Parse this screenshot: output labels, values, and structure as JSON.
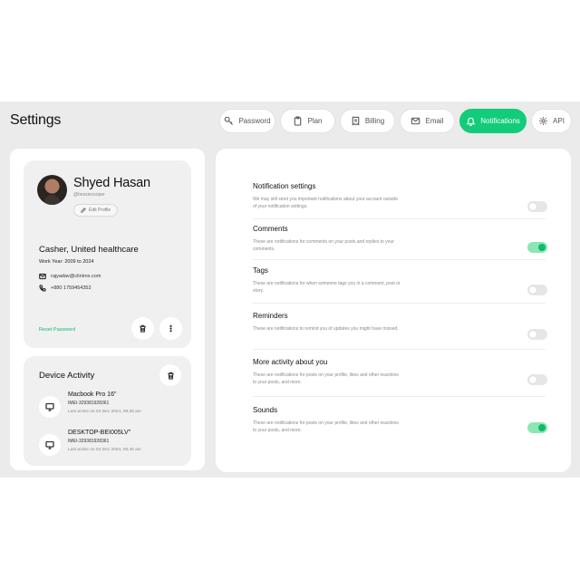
{
  "header": {
    "title": "Settings"
  },
  "tabs": [
    {
      "label": "Password",
      "icon": "key-icon",
      "active": false
    },
    {
      "label": "Plan",
      "icon": "clipboard-icon",
      "active": false
    },
    {
      "label": "Billing",
      "icon": "receipt-icon",
      "active": false
    },
    {
      "label": "Email",
      "icon": "mail-icon",
      "active": false
    },
    {
      "label": "Notifications",
      "icon": "bell-icon",
      "active": true
    },
    {
      "label": "API",
      "icon": "gear-icon",
      "active": false
    }
  ],
  "profile": {
    "name": "Shyed Hasan",
    "handle": "@bessiecooper",
    "edit_label": "Edit Profile",
    "job_title": "Casher, United healthcare",
    "work_year": "Work Year: 2009 to 2024",
    "email": "rajyadav@clinirox.com",
    "phone": "+880 1759454352",
    "reset_label": "Reset Password"
  },
  "device_activity": {
    "title": "Device Activity",
    "devices": [
      {
        "name": "Macbook Pro 16\"",
        "imei": "IMEI-329381928361",
        "last_active": "Last active on 04 Dec 2024, 08:28 am"
      },
      {
        "name": "DESKTOP-BEI005LV\"",
        "imei": "IMEI-329381928361",
        "last_active": "Last active on 04 Dec 2024, 06:45 am"
      }
    ]
  },
  "notifications": [
    {
      "title": "Notification settings",
      "desc": "We may still send you important notifications about your account outside of your notification settings.",
      "enabled": false
    },
    {
      "title": "Comments",
      "desc": "These are notifications for comments on your posts and replies to your comments.",
      "enabled": true
    },
    {
      "title": "Tags",
      "desc": "These are notifications for when someone tags you in a comment, post or story.",
      "enabled": false
    },
    {
      "title": "Reminders",
      "desc": "These are notifications to remind you of updates you might have missed.",
      "enabled": false
    },
    {
      "title": "More activity about you",
      "desc": "These are notifications for posts on your profile, likes and other reactions to your posts, and more.",
      "enabled": false
    },
    {
      "title": "Sounds",
      "desc": "These are notifications for posts on your profile, likes and other reactions to your posts, and more.",
      "enabled": true
    }
  ],
  "colors": {
    "accent": "#12cc7a",
    "toggle_on": "#12b86d",
    "background": "#ebebeb"
  }
}
